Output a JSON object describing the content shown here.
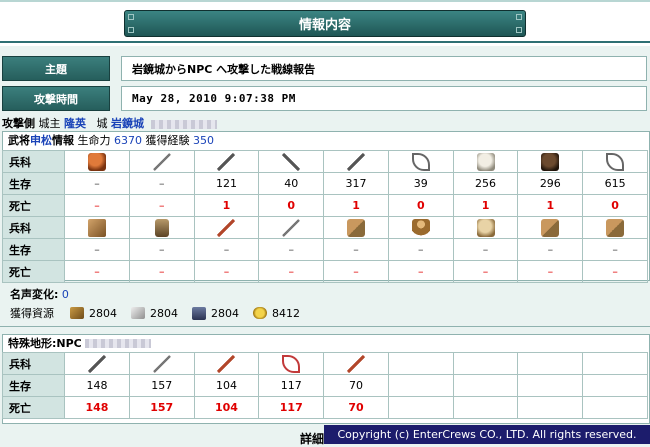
{
  "banner_title": "情報内容",
  "subject": {
    "label": "主題",
    "value": "岩鏡城からNPC へ攻撃した戦線報告"
  },
  "attack_time": {
    "label": "攻撃時間",
    "value": "May 28, 2010 9:07:38 PM"
  },
  "attacker_line": {
    "side": "攻撃側",
    "lord_label": "城主",
    "lord_name": "隆英",
    "castle_label": "城",
    "castle_name": "岩鏡城"
  },
  "general": {
    "prefix": "武将",
    "name": "申松",
    "info_label": "情報",
    "hp_label": "生命力",
    "hp": "6370",
    "exp_label": "獲得経験",
    "exp": "350"
  },
  "attacker_table": {
    "row_labels": [
      "兵科",
      "生存",
      "死亡"
    ],
    "row1_icons": [
      "horse-icon",
      "sword-icon",
      "pike-icon",
      "trident-icon",
      "spear-icon",
      "bow-icon",
      "white-horse-icon",
      "black-horse-icon",
      "crossbow-icon"
    ],
    "row1_alive": [
      "–",
      "–",
      "121",
      "40",
      "317",
      "39",
      "256",
      "296",
      "615"
    ],
    "row1_dead": [
      "–",
      "–",
      "1",
      "0",
      "1",
      "0",
      "1",
      "1",
      "0"
    ],
    "row2_icons": [
      "cart-icon",
      "siege-tower-icon",
      "red-pike-icon",
      "crossed-swords-icon",
      "ballista-icon",
      "warrior-icon",
      "tan-horse-icon",
      "catapult-icon",
      "heavy-catapult-icon"
    ],
    "row2_alive": [
      "–",
      "–",
      "–",
      "–",
      "–",
      "–",
      "–",
      "–",
      "–"
    ],
    "row2_dead": [
      "–",
      "–",
      "–",
      "–",
      "–",
      "–",
      "–",
      "–",
      "–"
    ]
  },
  "fame": {
    "label": "名声変化:",
    "value": "0"
  },
  "resources": {
    "label": "獲得資源",
    "items": [
      {
        "icon": "wood-icon",
        "value": "2804"
      },
      {
        "icon": "cloth-icon",
        "value": "2804"
      },
      {
        "icon": "iron-icon",
        "value": "2804"
      },
      {
        "icon": "food-icon",
        "value": "8412"
      }
    ]
  },
  "terrain": {
    "label": "特殊地形:",
    "owner": "NPC"
  },
  "defender_table": {
    "row_labels": [
      "兵科",
      "生存",
      "死亡"
    ],
    "icons": [
      "spear-icon",
      "sword-icon",
      "red-pike-icon",
      "red-bow-icon",
      "red-sword-icon"
    ],
    "alive": [
      "148",
      "157",
      "104",
      "117",
      "70"
    ],
    "dead": [
      "148",
      "157",
      "104",
      "117",
      "70"
    ]
  },
  "detail_label": "詳細",
  "copyright": "Copyright (c) EnterCrews CO., LTD. All rights reserved."
}
